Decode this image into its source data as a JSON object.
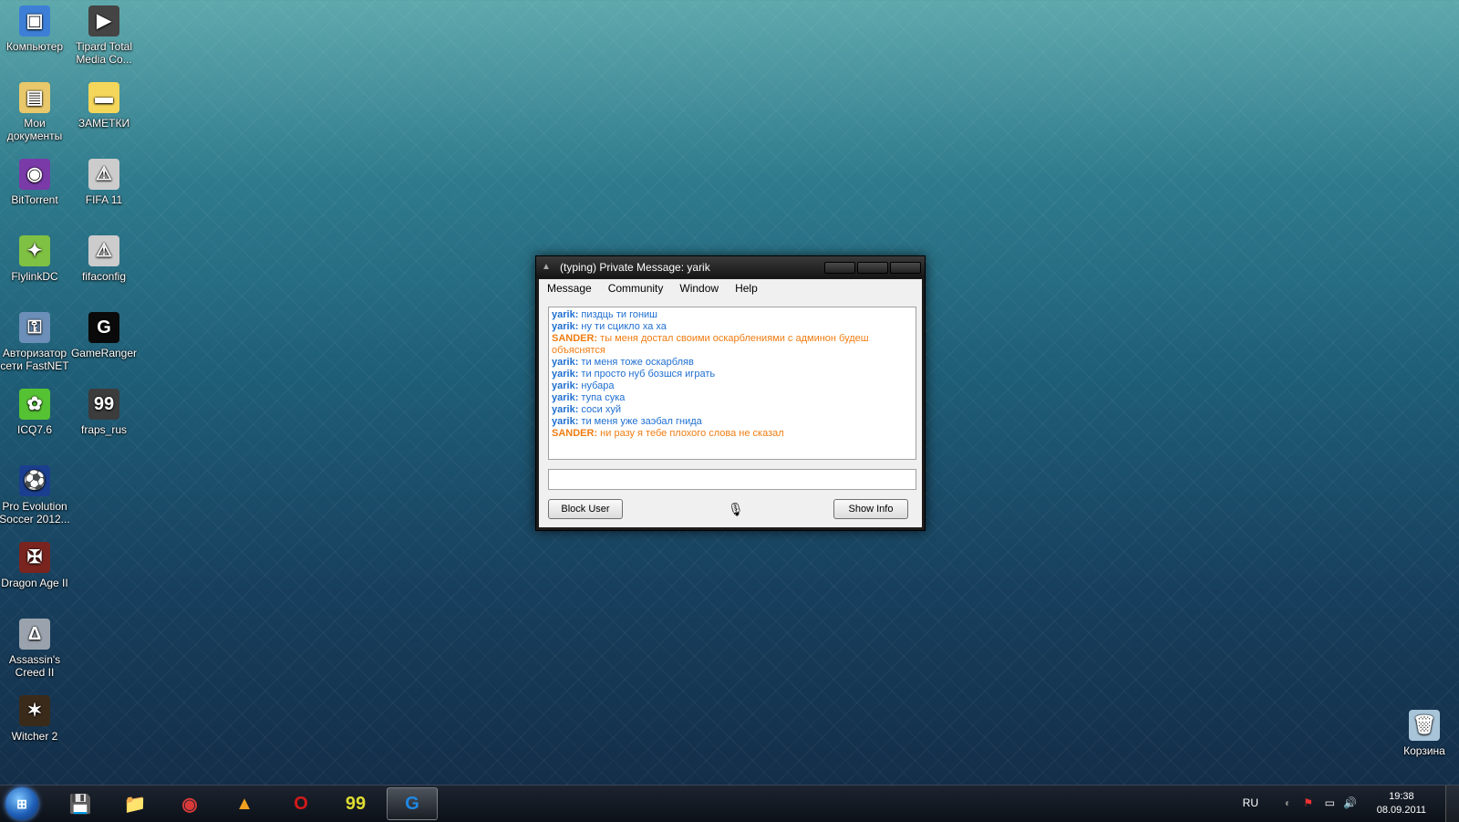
{
  "desktop": {
    "icons": [
      {
        "label": "Компьютер",
        "glyph": "▣",
        "color": "#3d7fd6"
      },
      {
        "label": "Tipard Total Media Co...",
        "glyph": "▶",
        "color": "#444444"
      },
      {
        "label": "Мои документы",
        "glyph": "▤",
        "color": "#e8c86a"
      },
      {
        "label": "ЗАМЕТКИ",
        "glyph": "▬",
        "color": "#f4d65a"
      },
      {
        "label": "BitTorrent",
        "glyph": "◉",
        "color": "#7a3aa8"
      },
      {
        "label": "FIFA 11",
        "glyph": "⚠",
        "color": "#cccccc"
      },
      {
        "label": "FlylinkDC",
        "glyph": "✦",
        "color": "#7fc142"
      },
      {
        "label": "fifaconfig",
        "glyph": "⚠",
        "color": "#cccccc"
      },
      {
        "label": "Авторизатор сети FastNET",
        "glyph": "⚿",
        "color": "#6b8fb8"
      },
      {
        "label": "GameRanger",
        "glyph": "G",
        "color": "#0a0a0a"
      },
      {
        "label": "ICQ7.6",
        "glyph": "✿",
        "color": "#55c234"
      },
      {
        "label": "fraps_rus",
        "glyph": "99",
        "color": "#3c3c3c"
      },
      {
        "label": "Pro Evolution Soccer 2012...",
        "glyph": "⚽",
        "color": "#1b3f8f"
      },
      {
        "label": "Dragon Age II",
        "glyph": "✠",
        "color": "#7a2420"
      },
      {
        "label": "Assassin's Creed II",
        "glyph": "Δ",
        "color": "#9aa3ad"
      },
      {
        "label": "Witcher 2",
        "glyph": "✶",
        "color": "#3a2a1a"
      },
      {
        "label": "Корзина",
        "glyph": "🗑",
        "color": "#a8c4d8"
      }
    ]
  },
  "window": {
    "title": "(typing) Private Message: yarik",
    "menu": [
      "Message",
      "Community",
      "Window",
      "Help"
    ],
    "messages": [
      {
        "user": "yarik:",
        "text": " пиздць ти гониш",
        "self": false
      },
      {
        "user": "yarik:",
        "text": " ну ти сцикло ха ха",
        "self": false
      },
      {
        "user": "SANDER:",
        "text": " ты меня достал своими оскарблениями с админон будеш объяснятся",
        "self": true
      },
      {
        "user": "yarik:",
        "text": " ти меня тоже оскарбляв",
        "self": false
      },
      {
        "user": "yarik:",
        "text": " ти просто нуб бозшся играть",
        "self": false
      },
      {
        "user": "yarik:",
        "text": " нубара",
        "self": false
      },
      {
        "user": "yarik:",
        "text": " тупа сука",
        "self": false
      },
      {
        "user": "yarik:",
        "text": " соси хуй",
        "self": false
      },
      {
        "user": "yarik:",
        "text": " ти меня уже заэбал  гнида",
        "self": false
      },
      {
        "user": "SANDER:",
        "text": " ни разу я тебе плохого слова не сказал",
        "self": true
      }
    ],
    "message_input": "",
    "block_user_label": "Block User",
    "show_info_label": "Show Info"
  },
  "taskbar": {
    "apps": [
      {
        "name": "floppy",
        "glyph": "💾"
      },
      {
        "name": "explorer",
        "glyph": "📁"
      },
      {
        "name": "redapp",
        "glyph": "◉"
      },
      {
        "name": "aimp",
        "glyph": "▲"
      },
      {
        "name": "opera",
        "glyph": "O"
      },
      {
        "name": "fraps",
        "glyph": "99"
      },
      {
        "name": "gameranger",
        "glyph": "G"
      }
    ],
    "language": "RU",
    "time": "19:38",
    "date": "08.09.2011"
  }
}
